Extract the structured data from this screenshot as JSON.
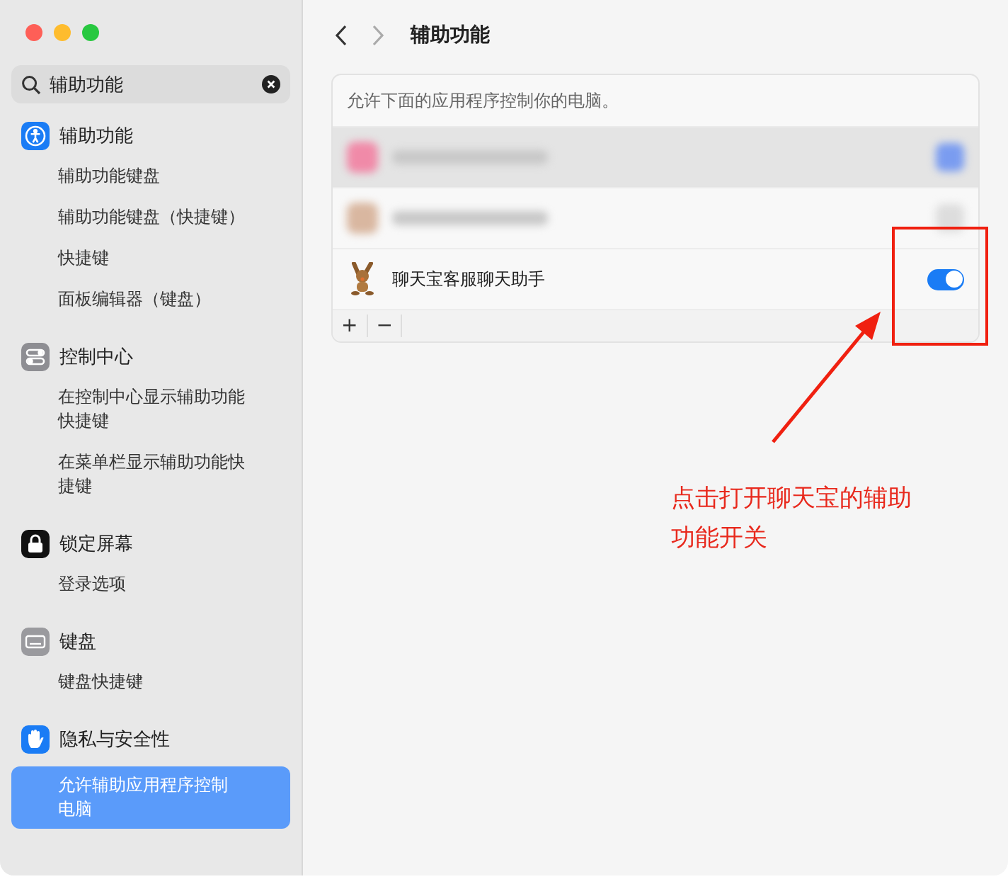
{
  "window": {
    "title": "辅助功能"
  },
  "search": {
    "value": "辅助功能"
  },
  "sidebar": {
    "groups": [
      {
        "kind": "accessibility",
        "label": "辅助功能",
        "items": [
          {
            "label": "辅助功能键盘",
            "selected": false
          },
          {
            "label": "辅助功能键盘（快捷键）",
            "selected": false
          },
          {
            "label": "快捷键",
            "selected": false
          },
          {
            "label": "面板编辑器（键盘）",
            "selected": false
          }
        ]
      },
      {
        "kind": "control-center",
        "label": "控制中心",
        "items": [
          {
            "label": "在控制中心显示辅助功能快捷键",
            "selected": false
          },
          {
            "label": "在菜单栏显示辅助功能快捷键",
            "selected": false
          }
        ]
      },
      {
        "kind": "lock",
        "label": "锁定屏幕",
        "items": [
          {
            "label": "登录选项",
            "selected": false
          }
        ]
      },
      {
        "kind": "keyboard",
        "label": "键盘",
        "items": [
          {
            "label": "键盘快捷键",
            "selected": false
          }
        ]
      },
      {
        "kind": "privacy",
        "label": "隐私与安全性",
        "items": [
          {
            "label": "允许辅助应用程序控制电脑",
            "selected": true
          }
        ]
      }
    ]
  },
  "panel": {
    "description": "允许下面的应用程序控制你的电脑。",
    "apps": [
      {
        "kind": "blurred",
        "on": true
      },
      {
        "kind": "blurred",
        "on": false
      },
      {
        "kind": "app",
        "name": "聊天宝客服聊天助手",
        "on": true
      }
    ],
    "footer_buttons": [
      "+",
      "−"
    ]
  },
  "annotation": {
    "text": "点击打开聊天宝的辅助功能开关"
  }
}
